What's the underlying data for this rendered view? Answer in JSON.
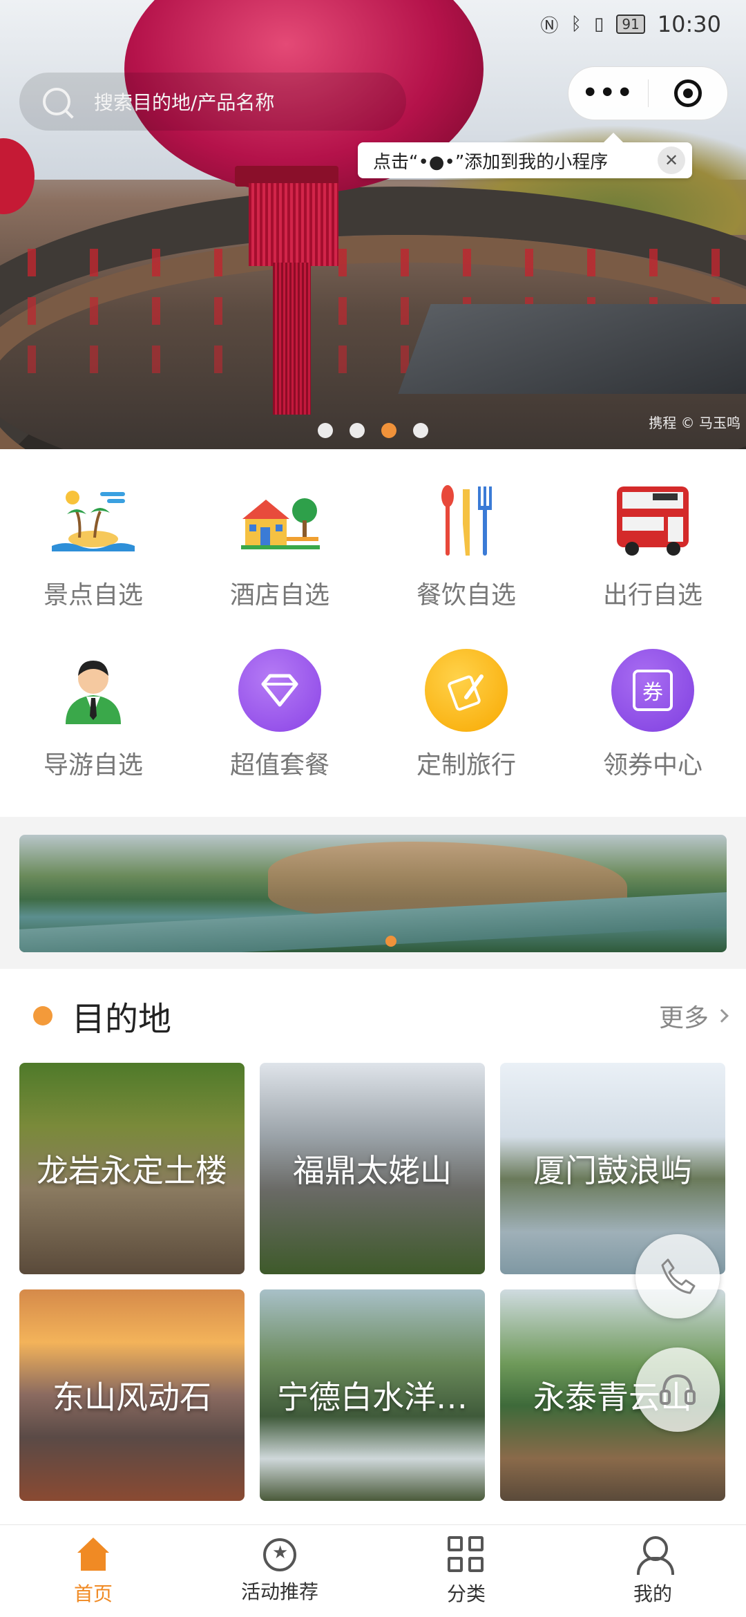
{
  "status_bar": {
    "time": "10:30",
    "battery": "91"
  },
  "search": {
    "placeholder": "搜索目的地/产品名称"
  },
  "capsule": {
    "more_label": "•••"
  },
  "tooltip": {
    "text": "点击“•●•”添加到我的小程序",
    "close": "✕"
  },
  "hero": {
    "credit": "携程 © 马玉鸣",
    "slides": 4,
    "active_slide": 3
  },
  "categories": [
    {
      "label": "景点自选",
      "icon": "island-icon"
    },
    {
      "label": "酒店自选",
      "icon": "hotel-icon"
    },
    {
      "label": "餐饮自选",
      "icon": "dining-icon"
    },
    {
      "label": "出行自选",
      "icon": "bus-icon"
    },
    {
      "label": "导游自选",
      "icon": "guide-icon"
    },
    {
      "label": "超值套餐",
      "icon": "diamond-icon"
    },
    {
      "label": "定制旅行",
      "icon": "pencil-icon"
    },
    {
      "label": "领券中心",
      "icon": "coupon-icon",
      "glyph": "券"
    }
  ],
  "destinations": {
    "title": "目的地",
    "more": "更多",
    "items": [
      {
        "name": "龙岩永定土楼"
      },
      {
        "name": "福鼎太姥山"
      },
      {
        "name": "厦门鼓浪屿"
      },
      {
        "name": "东山风动石"
      },
      {
        "name": "宁德白水洋…"
      },
      {
        "name": "永泰青云山"
      }
    ]
  },
  "tabbar": {
    "items": [
      {
        "label": "首页",
        "active": true
      },
      {
        "label": "活动推荐"
      },
      {
        "label": "分类"
      },
      {
        "label": "我的"
      }
    ]
  },
  "colors": {
    "accent": "#f08a24",
    "bullet": "#f39a3a"
  }
}
